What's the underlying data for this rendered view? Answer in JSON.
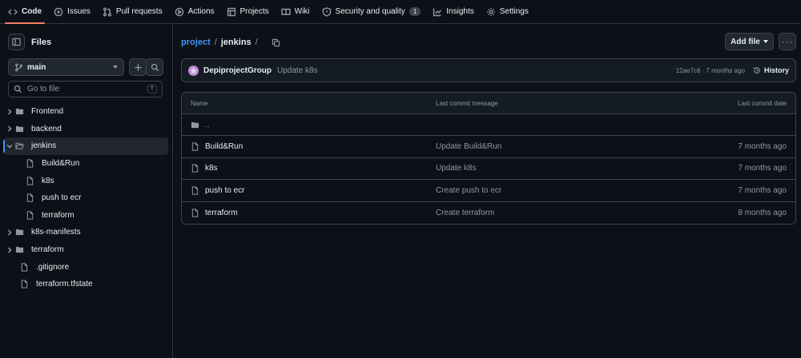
{
  "nav": {
    "items": [
      {
        "label": "Code",
        "icon": "code-icon",
        "active": true
      },
      {
        "label": "Issues",
        "icon": "issue-icon"
      },
      {
        "label": "Pull requests",
        "icon": "pull-request-icon"
      },
      {
        "label": "Actions",
        "icon": "play-icon"
      },
      {
        "label": "Projects",
        "icon": "table-icon"
      },
      {
        "label": "Wiki",
        "icon": "book-icon"
      },
      {
        "label": "Security and quality",
        "icon": "shield-icon",
        "counter": "1"
      },
      {
        "label": "Insights",
        "icon": "graph-icon"
      },
      {
        "label": "Settings",
        "icon": "gear-icon"
      }
    ]
  },
  "sidebar": {
    "title": "Files",
    "branch": "main",
    "search_placeholder": "Go to file",
    "search_shortcut": "T",
    "tree": [
      {
        "label": "Frontend",
        "type": "folder",
        "expanded": false,
        "depth": 0
      },
      {
        "label": "backend",
        "type": "folder",
        "expanded": false,
        "depth": 0
      },
      {
        "label": "jenkins",
        "type": "folder",
        "expanded": true,
        "selected": true,
        "depth": 0
      },
      {
        "label": "Build&Run",
        "type": "file",
        "depth": 1
      },
      {
        "label": "k8s",
        "type": "file",
        "depth": 1
      },
      {
        "label": "push to ecr",
        "type": "file",
        "depth": 1
      },
      {
        "label": "terraform",
        "type": "file",
        "depth": 1
      },
      {
        "label": "k8s-manifests",
        "type": "folder",
        "expanded": false,
        "depth": 0
      },
      {
        "label": "terraform",
        "type": "folder",
        "expanded": false,
        "depth": 0
      },
      {
        "label": ".gitignore",
        "type": "file",
        "depth": 0
      },
      {
        "label": "terraform.tfstate",
        "type": "file",
        "depth": 0
      }
    ]
  },
  "breadcrumb": {
    "repo": "project",
    "sep": "/",
    "current": "jenkins",
    "trail": "/"
  },
  "actions": {
    "add_file": "Add file",
    "more": "···"
  },
  "commit": {
    "author": "DepiprojectGroup",
    "message": "Update k8s",
    "meta": "12ae7c6 · 7 months ago",
    "history": "History"
  },
  "table": {
    "headers": {
      "name": "Name",
      "message": "Last commit message",
      "date": "Last commit date"
    },
    "parent": "..",
    "rows": [
      {
        "name": "Build&Run",
        "message": "Update Build&Run",
        "date": "7 months ago"
      },
      {
        "name": "k8s",
        "message": "Update k8s",
        "date": "7 months ago"
      },
      {
        "name": "push to ecr",
        "message": "Create push to ecr",
        "date": "7 months ago"
      },
      {
        "name": "terraform",
        "message": "Create terraform",
        "date": "8 months ago"
      }
    ]
  },
  "colors": {
    "accent": "#4493f8",
    "active_tab": "#f78166",
    "bg": "#0d1117",
    "border": "#3d444d"
  }
}
